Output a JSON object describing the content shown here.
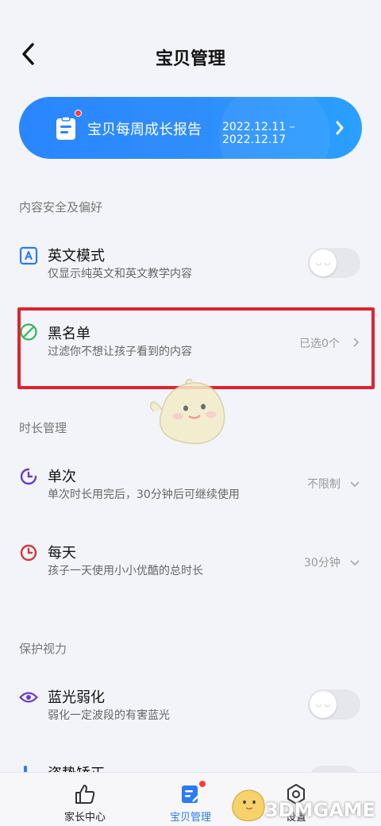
{
  "header": {
    "title": "宝贝管理"
  },
  "banner": {
    "title": "宝贝每周成长报告",
    "date_range": "2022.12.11 – 2022.12.17",
    "accent": "#2a86ff"
  },
  "sections": {
    "content": {
      "label": "内容安全及偏好",
      "english_mode": {
        "title": "英文模式",
        "subtitle": "仅显示纯英文和英文教学内容",
        "enabled": false
      },
      "blacklist": {
        "title": "黑名单",
        "subtitle": "过滤你不想让孩子看到的内容",
        "value": "已选0个"
      }
    },
    "time": {
      "label": "时长管理",
      "single": {
        "title": "单次",
        "subtitle": "单次时长用完后，30分钟后可继续使用",
        "value": "不限制"
      },
      "daily": {
        "title": "每天",
        "subtitle": "孩子一天使用小小优酷的总时长",
        "value": "30分钟"
      }
    },
    "eyes": {
      "label": "保护视力",
      "blue_light": {
        "title": "蓝光弱化",
        "subtitle": "弱化一定波段的有害蓝光",
        "enabled": false
      },
      "posture": {
        "title": "姿势矫正"
      }
    }
  },
  "bottom_nav": {
    "items": [
      {
        "label": "家长中心",
        "icon": "thumbs-up-icon"
      },
      {
        "label": "宝贝管理",
        "icon": "note-edit-icon"
      },
      {
        "label": "设置",
        "icon": "settings-hex-icon"
      }
    ],
    "active_index": 1
  },
  "watermark": "3DMGAME",
  "colors": {
    "highlight": "#e0222f",
    "primary": "#2a7bf5",
    "purple": "#6a3cc9",
    "red": "#d23a3a",
    "green": "#2dbb55"
  }
}
